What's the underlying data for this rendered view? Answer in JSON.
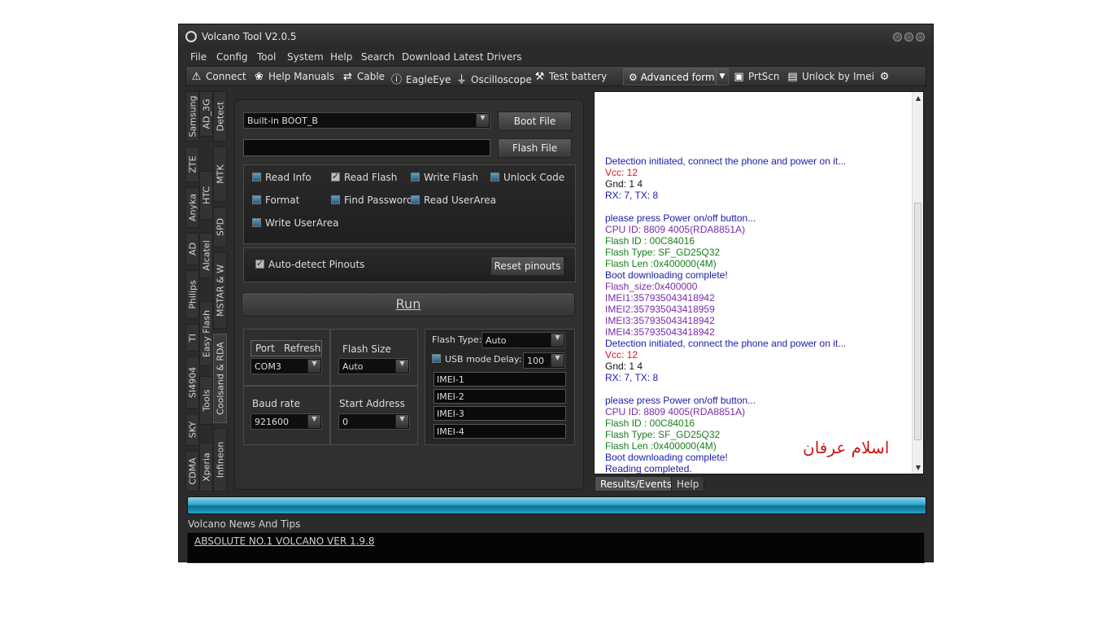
{
  "window": {
    "title": "Volcano Tool V2.0.5"
  },
  "menu": [
    "File",
    "Config",
    "Tool",
    "System",
    "Help",
    "Search",
    "Download Latest Drivers"
  ],
  "toolbar": {
    "connect": "Connect",
    "help_manuals": "Help Manuals",
    "cable": "Cable",
    "eagleeye": "EagleEye",
    "oscilloscope": "Oscilloscope",
    "test_battery": "Test battery",
    "advanced_form": "Advanced form",
    "prtscn": "PrtScn",
    "unlock_by_imei": "Unlock by Imei"
  },
  "vertical_tabs": {
    "col1": [
      "Samsung",
      "ZTE",
      "Anyka",
      "AD",
      "Philips",
      "TI",
      "SI4904",
      "SKY",
      "CDMA"
    ],
    "col2": [
      "AD_3G",
      "HTC",
      "Alcatel",
      "Easy Flash",
      "Tools",
      "Xperia"
    ],
    "col3": [
      "Detect",
      "MTK",
      "SPD",
      "MSTAR & W",
      "Coolsand & RDA",
      "Infineon"
    ],
    "active": "Coolsand & RDA"
  },
  "flash": {
    "boot_select": "Built-in BOOT_B",
    "boot_file_btn": "Boot File",
    "flash_file_value": "",
    "flash_file_btn": "Flash File"
  },
  "options": [
    {
      "label": "Read Info",
      "checked": false
    },
    {
      "label": "Read Flash",
      "checked": true
    },
    {
      "label": "Write Flash",
      "checked": false
    },
    {
      "label": "Unlock Code",
      "checked": false
    },
    {
      "label": "Format",
      "checked": false
    },
    {
      "label": "Find Password",
      "checked": false
    },
    {
      "label": "Read UserArea",
      "checked": false
    },
    {
      "label": "Write UserArea",
      "checked": false
    }
  ],
  "pinouts": {
    "auto_detect": "Auto-detect Pinouts",
    "auto_detect_checked": true,
    "reset_btn": "Reset pinouts"
  },
  "run_btn": "Run",
  "port": {
    "port_label": "Port",
    "refresh_label": "Refresh",
    "value": "COM3"
  },
  "flash_size": {
    "label": "Flash Size",
    "value": "Auto"
  },
  "baud": {
    "label": "Baud rate",
    "value": "921600"
  },
  "start_address": {
    "label": "Start Address",
    "value": "0"
  },
  "flash_type": {
    "label": "Flash Type:",
    "value": "Auto"
  },
  "usb_mode": {
    "label": "USB mode",
    "checked": false
  },
  "delay": {
    "label": "Delay:",
    "value": "100"
  },
  "imei_fields": [
    "IMEI-1",
    "IMEI-2",
    "IMEI-3",
    "IMEI-4"
  ],
  "log": [
    {
      "text": "Detection initiated, connect the phone and power on it...",
      "color": "#1a1aa8"
    },
    {
      "text": "Vcc: 12",
      "color": "#d81818"
    },
    {
      "text": "Gnd: 1 4",
      "color": "#111111"
    },
    {
      "text": "RX: 7, TX: 8",
      "color": "#1a1aa8"
    },
    {
      "text": "",
      "color": "#111111"
    },
    {
      "text": "please press Power on/off button...",
      "color": "#1a1aa8"
    },
    {
      "text": "CPU ID: 8809 4005(RDA8851A)",
      "color": "#7a2aa8"
    },
    {
      "text": "Flash ID : 00C84016",
      "color": "#18801c"
    },
    {
      "text": "Flash Type: SF_GD25Q32",
      "color": "#18801c"
    },
    {
      "text": "Flash Len :0x400000(4M)",
      "color": "#18801c"
    },
    {
      "text": "Boot downloading complete!",
      "color": "#1a1aa8"
    },
    {
      "text": "Flash_size:0x400000",
      "color": "#7a2aa8"
    },
    {
      "text": "IMEI1:357935043418942",
      "color": "#7a2aa8"
    },
    {
      "text": "IMEI2:357935043418959",
      "color": "#7a2aa8"
    },
    {
      "text": "IMEI3:357935043418942",
      "color": "#7a2aa8"
    },
    {
      "text": "IMEI4:357935043418942",
      "color": "#7a2aa8"
    },
    {
      "text": "Detection initiated, connect the phone and power on it...",
      "color": "#1a1aa8"
    },
    {
      "text": "Vcc: 12",
      "color": "#d81818"
    },
    {
      "text": "Gnd: 1 4",
      "color": "#111111"
    },
    {
      "text": "RX: 7, TX: 8",
      "color": "#1a1aa8"
    },
    {
      "text": "",
      "color": "#111111"
    },
    {
      "text": "please press Power on/off button...",
      "color": "#1a1aa8"
    },
    {
      "text": "CPU ID: 8809 4005(RDA8851A)",
      "color": "#7a2aa8"
    },
    {
      "text": "Flash ID : 00C84016",
      "color": "#18801c"
    },
    {
      "text": "Flash Type: SF_GD25Q32",
      "color": "#18801c"
    },
    {
      "text": "Flash Len :0x400000(4M)",
      "color": "#18801c"
    },
    {
      "text": "Boot downloading complete!",
      "color": "#1a1aa8"
    },
    {
      "text": "Reading completed.",
      "color": "#1a1aa8"
    }
  ],
  "watermark_text": "اسلام عرفان",
  "result_tabs": [
    "Results/Events",
    "Help"
  ],
  "news": {
    "heading": "Volcano News And Tips",
    "link": "ABSOLUTE NO.1 VOLCANO VER 1.9.8"
  }
}
